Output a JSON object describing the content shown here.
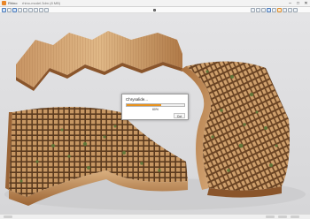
{
  "window": {
    "app_name": "Rhino",
    "document_title": "rhino-model.3dm (8 MB)",
    "minimize_icon": "minimize-icon",
    "maximize_icon": "maximize-icon",
    "close_icon": "close-icon",
    "minimize_glyph": "–",
    "maximize_glyph": "□",
    "close_glyph": "✕"
  },
  "toolbar": {
    "left_icons": [
      "new-file-icon",
      "open-icon",
      "save-icon",
      "print-icon",
      "undo-icon",
      "redo-icon",
      "cut-icon",
      "copy-icon",
      "paste-icon"
    ],
    "center_marker_icon": "cursor-icon",
    "right_icons": [
      "zoom-icon",
      "pan-icon",
      "rotate-icon",
      "view-icon",
      "render-icon",
      "material-icon",
      "layer-icon",
      "settings-icon",
      "help-icon"
    ]
  },
  "dialog": {
    "title": "Chrysalide...",
    "progress_percent": 0.6,
    "progress_text": "60%",
    "cancel_label": "Cut"
  },
  "colors": {
    "accent_orange": "#e8921e",
    "wood_light": "#d7ab7a",
    "wood_dark": "#8f5a30",
    "moss_green": "#5f7a3a",
    "background": "#dcdcde"
  }
}
